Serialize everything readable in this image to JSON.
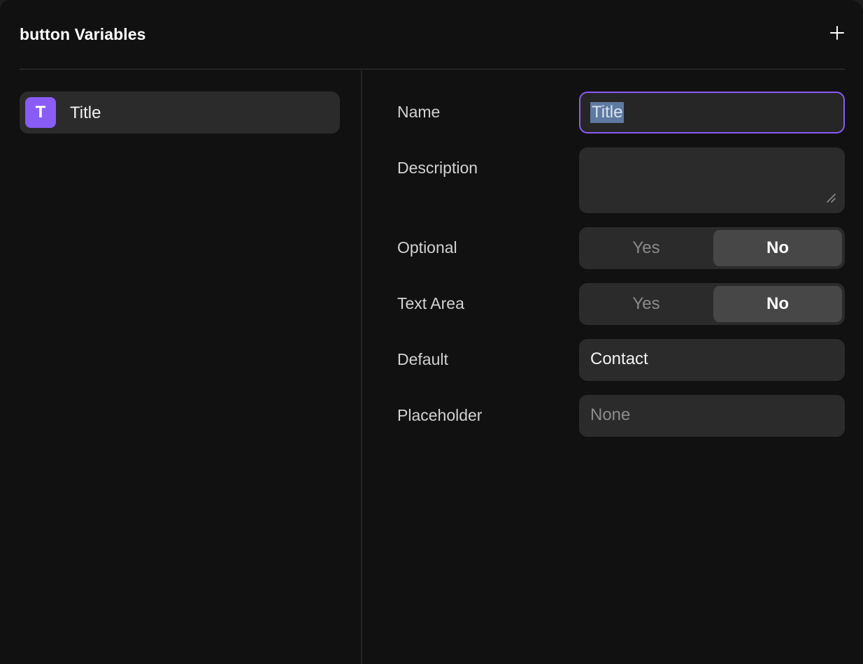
{
  "header": {
    "title": "button Variables",
    "add_icon": "plus-icon"
  },
  "variables": [
    {
      "type_icon_letter": "T",
      "type_icon": "text-type-icon",
      "label": "Title"
    }
  ],
  "form": {
    "name": {
      "label": "Name",
      "value": "Title"
    },
    "description": {
      "label": "Description",
      "value": ""
    },
    "optional": {
      "label": "Optional",
      "options": [
        "Yes",
        "No"
      ],
      "selected": "No"
    },
    "text_area": {
      "label": "Text Area",
      "options": [
        "Yes",
        "No"
      ],
      "selected": "No"
    },
    "default": {
      "label": "Default",
      "value": "Contact"
    },
    "placeholder": {
      "label": "Placeholder",
      "value": "",
      "placeholder": "None"
    }
  },
  "colors": {
    "accent": "#8a5cf6",
    "background": "#111111",
    "field": "#2b2b2b"
  }
}
